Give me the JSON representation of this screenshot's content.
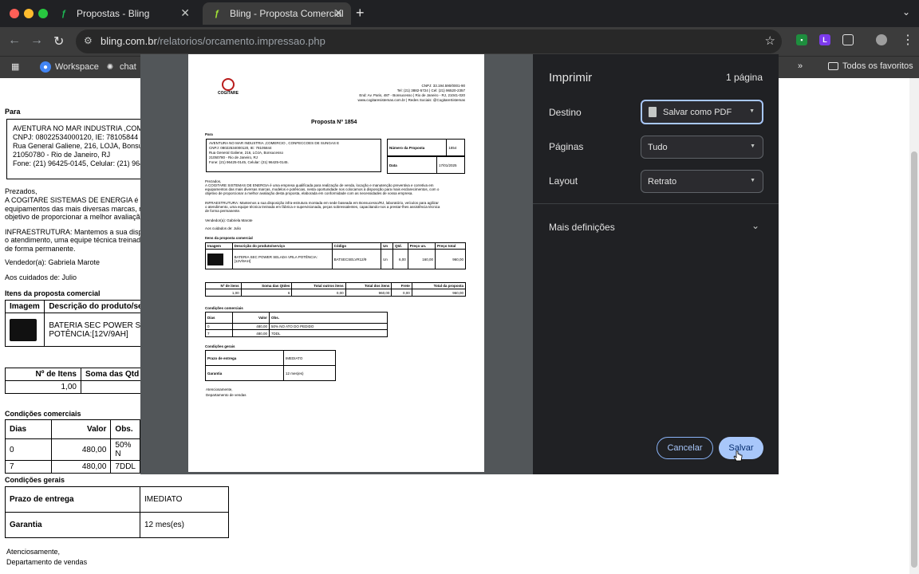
{
  "browser": {
    "tabs": [
      {
        "title": "Propostas - Bling",
        "active": false
      },
      {
        "title": "Bling - Proposta Comercial",
        "active": true
      }
    ],
    "url_host": "bling.com.br",
    "url_path": "/relatorios/orcamento.impressao.php",
    "bookmarks": [
      "Workspace",
      "chat"
    ],
    "all_favorites": "Todos os favoritos"
  },
  "background_page": {
    "para": "Para",
    "client_lines": [
      "AVENTURA NO MAR INDUSTRIA ,COME",
      "CNPJ: 08022534000120, IE: 78105844",
      "Rua General Galiene, 216, LOJA, Bonsucc",
      "21050780 - Rio de Janeiro, RJ",
      "Fone: (21) 96425-0145, Celular: (21) 9642"
    ],
    "prezados": "Prezados,",
    "intro_lines": [
      "A COGITARE SISTEMAS DE ENERGIA é um",
      "equipamentos das mais diversas marcas, mo",
      "objetivo de proporcionar a melhor avaliação d"
    ],
    "infra_lines": [
      "INFRAESTRUTURA: Mantemos a sua dispos",
      "o atendimento, uma equipe técnica treinada e",
      "de forma permanente."
    ],
    "vendedor": "Vendedor(a): Gabriela Marote",
    "cuidados": "Aos cuidados de: Julio",
    "itens_title": "Itens da proposta comercial",
    "itens_headers": [
      "Imagem",
      "Descrição do produto/se"
    ],
    "item_desc_lines": [
      "BATERIA SEC POWER S",
      "POTÊNCIA:[12V/9AH]"
    ],
    "totals_headers": [
      "Nº de Itens",
      "Soma das Qtd"
    ],
    "totals_values": [
      "1,00",
      ""
    ],
    "cond_com_title": "Condições comerciais",
    "cond_headers": [
      "Dias",
      "Valor",
      "Obs."
    ],
    "cond_rows": [
      [
        "0",
        "480,00",
        "50% N"
      ],
      [
        "7",
        "480,00",
        "7DDL"
      ]
    ],
    "cond_gerais_title": "Condições gerais",
    "gerais_rows": [
      [
        "Prazo de entrega",
        "IMEDIATO"
      ],
      [
        "Garantia",
        "12 mes(es)"
      ]
    ],
    "closing": [
      "Atenciosamente,",
      "Departamento de vendas"
    ]
  },
  "preview": {
    "logo_text": "COGITARE",
    "header_lines": [
      "CNPJ: 33.194.590/0001-90",
      "Tel: (21) 3882-5724 | Cel: (21) 96520-2357",
      "End: Av. Paris, 487 - Bonsucesso | Rio de Janeiro - RJ, 21041-020",
      "www.cogitaresistemas.com.br | Redes Sociais: @CogitareSistemas"
    ],
    "title": "Proposta Nº 1854",
    "para": "Para",
    "client_lines": [
      "AVENTURA NO MAR INDUSTRIA ,COMERCIO , CONFECCOES DE SUNGAS E",
      "CNPJ: 08022534000120, IE: 78105844",
      "Rua General Galiene, 216, LOJA, Bonsucesso",
      "21050780 - Rio de Janeiro, RJ",
      "Fone: (21) 96425-0145, Celular: (21) 96425-0145."
    ],
    "numero_label": "Número da Proposta",
    "numero_value": "1854",
    "data_label": "Data",
    "data_value": "17/01/2025",
    "prezados": "Prezados,",
    "intro_lines": [
      "A COGITARE SISTEMAS DE ENERGIA é uma empresa qualificada para realização de venda, locação e manutenção preventiva e corretiva em",
      "equipamentos das mais diversas marcas, modelos e potências, nesta oportunidade nos colocamos à disposição para mais esclarecimentos, com o",
      "objetivo de proporcionar a melhor avaliação desta proposta, elaborada em conformidade com as necessidades de vossa empresa."
    ],
    "infra_lines": [
      "INFRAESTRUTURA: Mantemos a sua disposição infra-estrutura montada em sede baseada em Bonsucesso/RJ, laboratório, veículos para agilizar",
      "o atendimento, uma equipe técnica treinada em fábrica e supervisionada, peças sobressalentes, capacitando-nos a prestar-lhes assistência técnica",
      "de forma permanente."
    ],
    "vendedor": "Vendedor(a): Gabriela Marote",
    "cuidados": "Aos cuidados de: Julio",
    "itens_title": "Itens da proposta comercial",
    "itens_headers": [
      "Imagem",
      "Descrição do produto/serviço",
      "Código",
      "Un",
      "Qtd.",
      "Preço un.",
      "Preço total"
    ],
    "item_row": [
      "BATERIA SEC POWER SELADA VRLA POTÊNCIA:[12V/9AH]",
      "BATSECSELVR12/9",
      "Un",
      "6,00",
      "160,00",
      "960,00"
    ],
    "totals_headers": [
      "Nº de itens",
      "Soma das Qtdes",
      "Total outros itens",
      "Total dos itens",
      "Frete",
      "Total da proposta"
    ],
    "totals_values": [
      "1,00",
      "6",
      "0,00",
      "960,00",
      "0,00",
      "960,00"
    ],
    "cond_com_title": "Condições comerciais",
    "cond_headers": [
      "Dias",
      "Valor",
      "Obs."
    ],
    "cond_rows": [
      [
        "0",
        "480,00",
        "50% NO ATO DO PEDIDO"
      ],
      [
        "7",
        "480,00",
        "7DDL"
      ]
    ],
    "cond_gerais_title": "Condições gerais",
    "gerais_rows": [
      [
        "Prazo de entrega",
        "IMEDIATO"
      ],
      [
        "Garantia",
        "12 mes(es)"
      ]
    ],
    "closing": [
      "Atenciosamente,",
      "Departamento de vendas"
    ]
  },
  "print_panel": {
    "title": "Imprimir",
    "page_count": "1 página",
    "destino_label": "Destino",
    "destino_value": "Salvar como PDF",
    "paginas_label": "Páginas",
    "paginas_value": "Tudo",
    "layout_label": "Layout",
    "layout_value": "Retrato",
    "more_label": "Mais definições",
    "cancel_label": "Cancelar",
    "save_label": "Salvar"
  }
}
